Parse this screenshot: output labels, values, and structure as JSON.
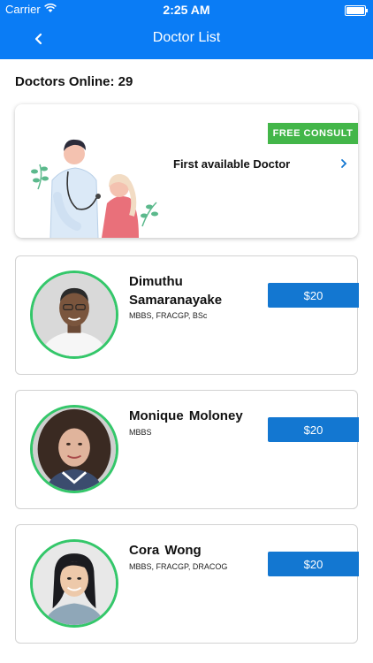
{
  "status_bar": {
    "carrier": "Carrier",
    "time": "2:25 AM"
  },
  "nav": {
    "title": "Doctor List"
  },
  "online": {
    "label": "Doctors Online: 29"
  },
  "first_available": {
    "badge": "FREE CONSULT",
    "label": "First available Doctor"
  },
  "doctors": [
    {
      "name": "Dimuthu Samaranayake",
      "qualifications": "MBBS, FRACGP, BSc",
      "price": "$20"
    },
    {
      "name": "Monique  Moloney",
      "qualifications": "MBBS",
      "price": "$20"
    },
    {
      "name": "Cora  Wong",
      "qualifications": "MBBS, FRACGP, DRACOG",
      "price": "$20"
    }
  ],
  "colors": {
    "primary": "#0a7cf5",
    "price_button": "#1377d1",
    "free_badge": "#43b649",
    "avatar_ring": "#34c76a"
  }
}
